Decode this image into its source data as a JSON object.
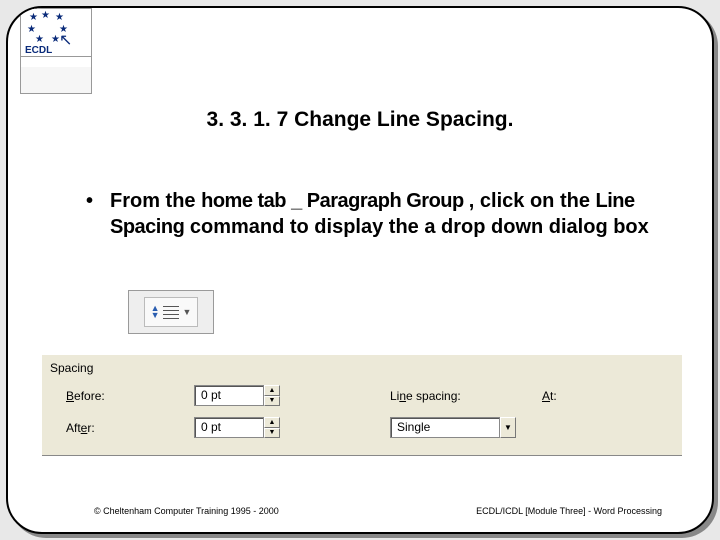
{
  "logo": {
    "text": "ECDL"
  },
  "title": "3. 3. 1. 7 Change Line Spacing.",
  "body": {
    "pre": "From the ",
    "b1": "home tab _ Paragraph Group ",
    "mid1": ", click on the ",
    "b2": "Line Spacing",
    "post": " command to display the a drop down dialog box"
  },
  "panel": {
    "section": "Spacing",
    "before_label_pre": "B",
    "before_label_post": "efore:",
    "after_label_pre": "Aft",
    "after_label_u": "e",
    "after_label_post": "r:",
    "before_value": "0 pt",
    "after_value": "0 pt",
    "line_spacing_label_pre": "Li",
    "line_spacing_label_u": "n",
    "line_spacing_label_post": "e spacing:",
    "line_spacing_value": "Single",
    "at_label_pre": "A",
    "at_label_post": "t:"
  },
  "footer": {
    "left": "© Cheltenham Computer Training 1995 - 2000",
    "right": "ECDL/ICDL [Module Three] - Word Processing"
  }
}
